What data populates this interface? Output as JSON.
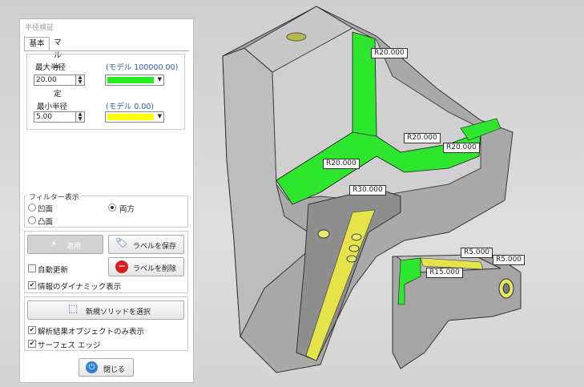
{
  "panel": {
    "title": "半径検証",
    "tabs": [
      {
        "label": "基本"
      },
      {
        "label": "マルチ設定"
      }
    ],
    "max_radius": {
      "label": "最大半径",
      "model_note": "(モデル 100000.00)",
      "value": "20.00",
      "color": "#22ee22"
    },
    "min_radius": {
      "label": "最小半径",
      "model_note": "(モデル 0.00)",
      "value": "5.00",
      "color": "#ffff00"
    },
    "filter": {
      "legend": "フィルター表示",
      "concave": "凹面",
      "both": "両方",
      "convex": "凸面",
      "selected": "both"
    },
    "apply_label": "適用",
    "save_label": "ラベルを保存",
    "delete_label": "ラベルを削除",
    "auto_update": {
      "label": "自動更新",
      "checked": false
    },
    "dynamic_info": {
      "label": "情報のダイナミック表示",
      "checked": true
    },
    "select_solid_label": "新規ソリッドを選択",
    "analysis_only": {
      "label": "解析結果オブジェクトのみ表示",
      "checked": true
    },
    "surface_edge": {
      "label": "サーフェス エッジ",
      "checked": true
    },
    "close_label": "閉じる"
  },
  "model_labels": [
    "R20.000",
    "R20.000",
    "R20.000",
    "R20.000",
    "R30.000",
    "R5.000",
    "R5.000",
    "R15.000"
  ]
}
